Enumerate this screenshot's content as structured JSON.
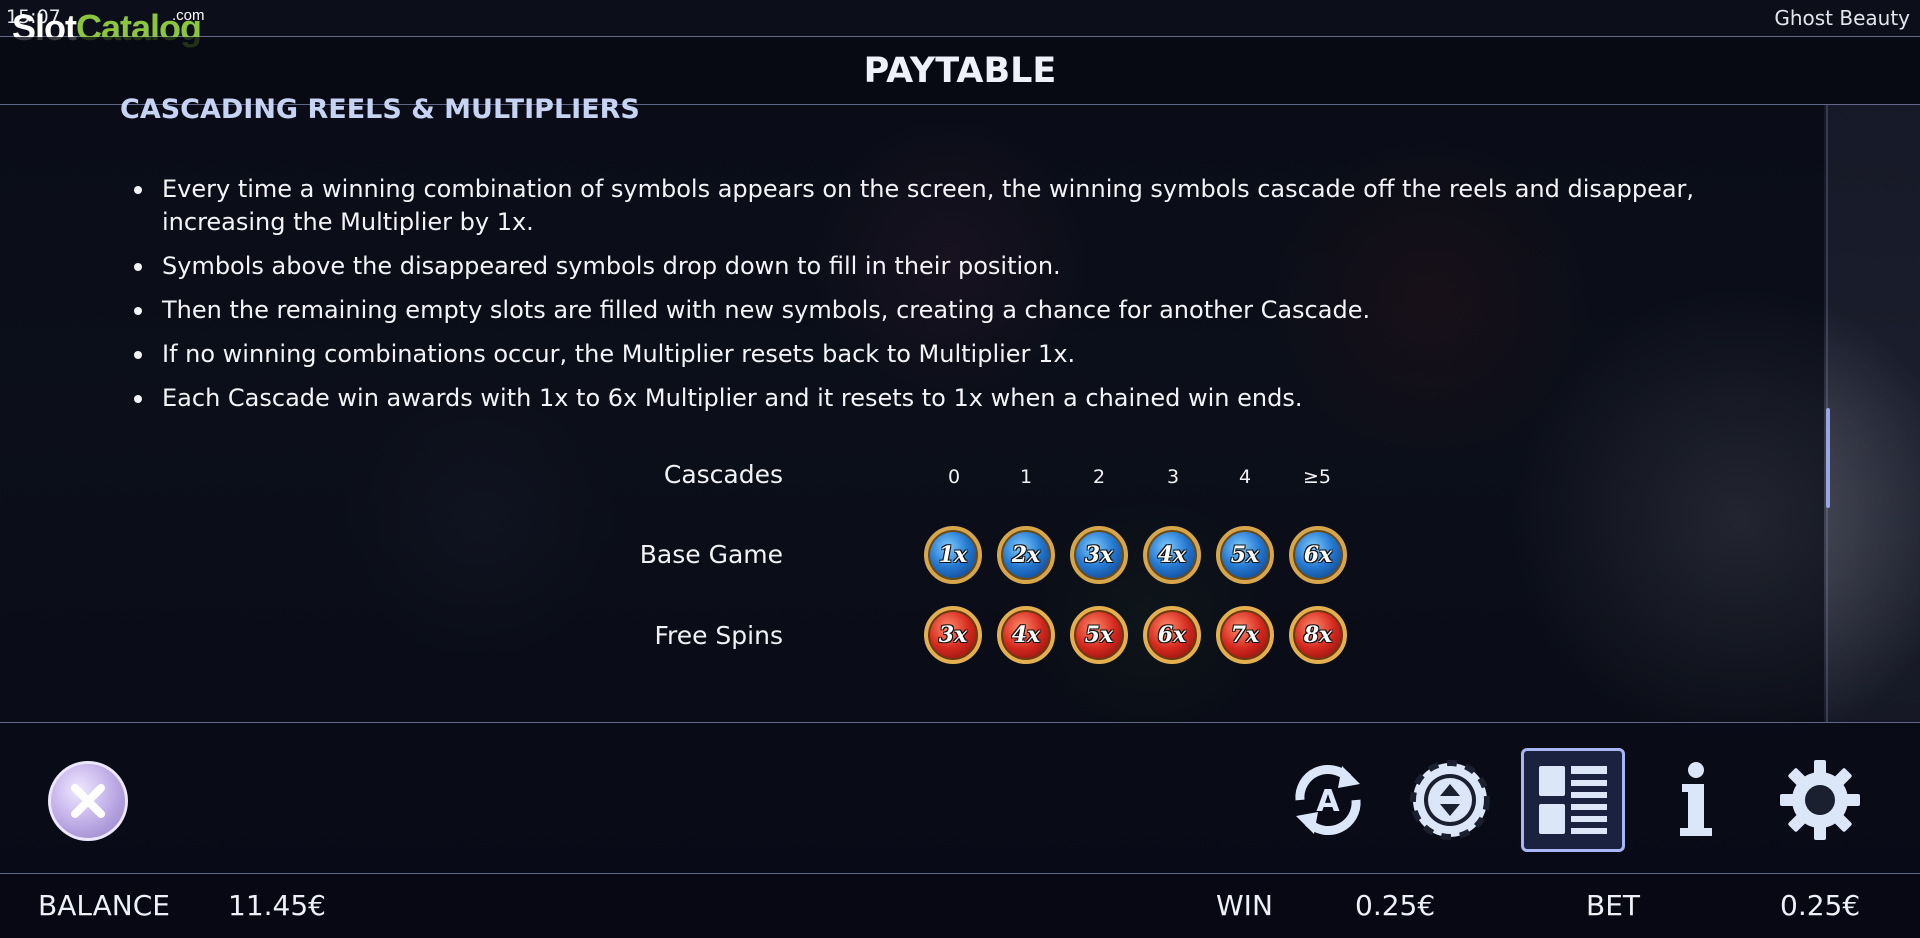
{
  "status": {
    "clock": "15:07",
    "game_title": "Ghost Beauty"
  },
  "logo": {
    "slot": "Slot",
    "catalog": "Catalog",
    "com": ".com",
    "colors": {
      "slot": "#ffffff",
      "catalog": "#8cc63f"
    }
  },
  "header": {
    "title": "PAYTABLE"
  },
  "section": {
    "title": "CASCADING REELS & MULTIPLIERS"
  },
  "rules": [
    "Every time a winning combination of symbols appears on the screen, the winning symbols cascade off the reels and disappear, increasing the Multiplier by 1x.",
    "Symbols above the disappeared symbols drop down to fill in their position.",
    "Then the remaining empty slots are filled with new symbols, creating a chance for another Cascade.",
    "If no winning combinations occur, the Multiplier resets back to Multiplier 1x.",
    "Each Cascade win awards with 1x to 6x Multiplier and it resets to 1x when a chained win ends."
  ],
  "multiplier_table": {
    "cascades_label": "Cascades",
    "cascades": [
      "0",
      "1",
      "2",
      "3",
      "4",
      "≥5"
    ],
    "base_game_label": "Base Game",
    "base_game": [
      "1x",
      "2x",
      "3x",
      "4x",
      "5x",
      "6x"
    ],
    "free_spins_label": "Free Spins",
    "free_spins": [
      "3x",
      "4x",
      "5x",
      "6x",
      "7x",
      "8x"
    ],
    "colors": {
      "base_game": "#2478d0",
      "free_spins": "#d4281e",
      "rim": "#d8a64a"
    }
  },
  "toolbar": {
    "close_icon": "close-x-icon",
    "buttons": [
      {
        "name": "autoplay",
        "icon": "autoplay-a-icon"
      },
      {
        "name": "bet",
        "icon": "chip-bet-icon"
      },
      {
        "name": "paytable",
        "icon": "paytable-list-icon",
        "active": true
      },
      {
        "name": "info",
        "icon": "info-i-icon"
      },
      {
        "name": "settings",
        "icon": "gear-icon"
      }
    ]
  },
  "footer": {
    "balance_label": "BALANCE",
    "balance_value": "11.45€",
    "win_label": "WIN",
    "win_value": "0.25€",
    "bet_label": "BET",
    "bet_value": "0.25€"
  }
}
